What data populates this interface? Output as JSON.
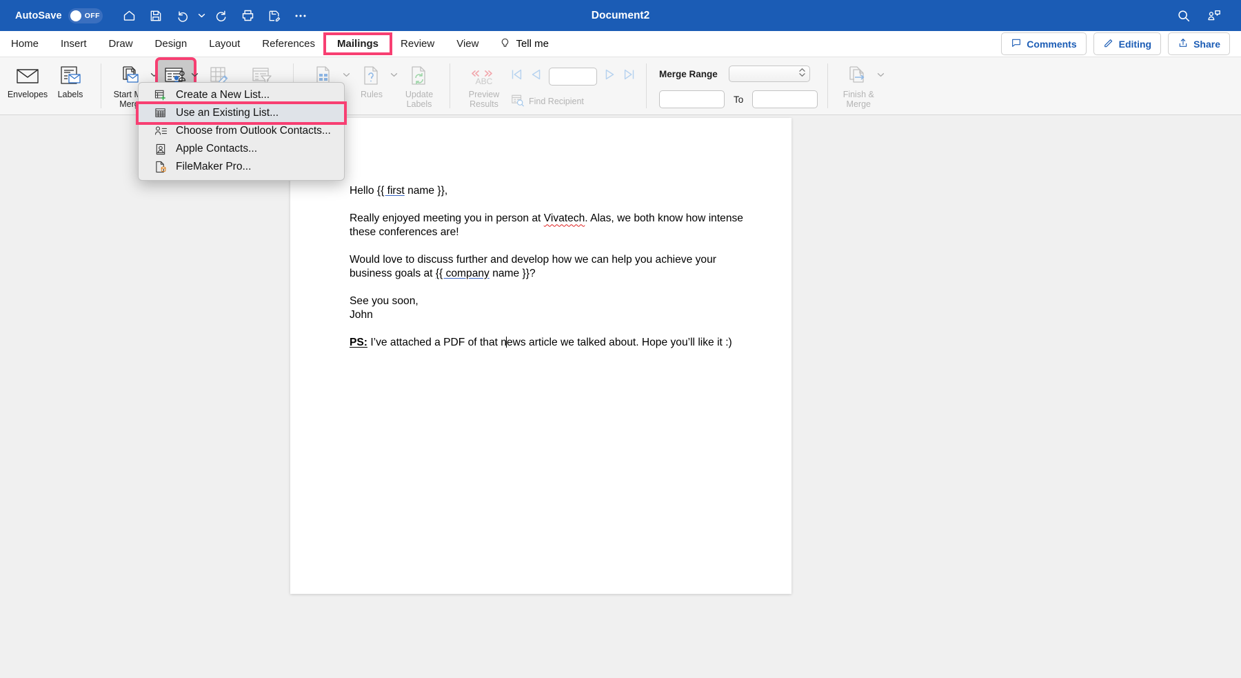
{
  "titlebar": {
    "autosave_label": "AutoSave",
    "autosave_state": "OFF",
    "document_title": "Document2",
    "icons": [
      "home-icon",
      "save-icon",
      "undo-icon",
      "undo-dropdown-caret",
      "redo-icon",
      "print-icon",
      "save-as-icon",
      "more-options-icon"
    ],
    "right_icons": [
      "search-icon",
      "collaborate-icon"
    ],
    "accent_color": "#1b5cb5"
  },
  "tabs": [
    {
      "label": "Home",
      "highlighted": false
    },
    {
      "label": "Insert",
      "highlighted": false
    },
    {
      "label": "Draw",
      "highlighted": false
    },
    {
      "label": "Design",
      "highlighted": false
    },
    {
      "label": "Layout",
      "highlighted": false
    },
    {
      "label": "References",
      "highlighted": false
    },
    {
      "label": "Mailings",
      "highlighted": true
    },
    {
      "label": "Review",
      "highlighted": false
    },
    {
      "label": "View",
      "highlighted": false
    }
  ],
  "tellme": {
    "label": "Tell me",
    "icon": "lightbulb-icon"
  },
  "tabbar_right": {
    "comments": {
      "label": "Comments",
      "icon": "comment-icon"
    },
    "editing": {
      "label": "Editing",
      "icon": "pencil-icon"
    },
    "share": {
      "label": "Share",
      "icon": "share-icon"
    }
  },
  "ribbon": {
    "create_group": [
      {
        "label": "Envelopes",
        "icon": "envelope-icon",
        "disabled": false
      },
      {
        "label": "Labels",
        "icon": "labels-icon",
        "disabled": false
      }
    ],
    "start_group": [
      {
        "label": "Start Mail\nMerge",
        "label_line1": "Start Mail",
        "label_line2": "Merge",
        "icon": "start-mail-merge-icon",
        "disabled": false,
        "has_caret": true
      },
      {
        "label": "",
        "icon": "select-recipients-icon",
        "disabled": false,
        "has_caret": true,
        "active": true
      },
      {
        "label": "",
        "icon": "edit-recipient-list-icon",
        "disabled": true,
        "has_caret": false
      },
      {
        "label": "",
        "icon": "filter-recipients-icon",
        "disabled": true,
        "has_caret": false
      }
    ],
    "write_group": [
      {
        "label": "",
        "icon": "insert-merge-field-icon",
        "disabled": true,
        "has_caret": true
      },
      {
        "label": "Rules",
        "icon": "rules-icon",
        "disabled": true,
        "has_caret": true
      },
      {
        "label_line1": "Update",
        "label_line2": "Labels",
        "icon": "update-labels-icon",
        "disabled": true,
        "has_caret": false
      }
    ],
    "preview_group": {
      "preview_results": {
        "label_line1": "Preview",
        "label_line2": "Results",
        "icon": "abc-preview-icon"
      },
      "nav": [
        "first-record-icon",
        "previous-record-icon",
        "next-record-icon",
        "last-record-icon"
      ],
      "record_value": "",
      "find_recipient": {
        "label": "Find Recipient",
        "icon": "find-recipient-icon"
      }
    },
    "merge_range": {
      "label": "Merge Range",
      "select_value": "",
      "from_value": "",
      "to_label": "To",
      "to_value": ""
    },
    "finish": {
      "label_line1": "Finish &",
      "label_line2": "Merge",
      "icon": "finish-merge-icon",
      "has_caret": true
    }
  },
  "menu": {
    "items": [
      {
        "label": "Create a New List...",
        "icon": "new-list-icon",
        "selected": false,
        "highlighted": false
      },
      {
        "label": "Use an Existing List...",
        "icon": "existing-list-icon",
        "selected": true,
        "highlighted": true
      },
      {
        "label": "Choose from Outlook Contacts...",
        "icon": "outlook-contacts-icon",
        "selected": false,
        "highlighted": false
      },
      {
        "label": "Apple Contacts...",
        "icon": "apple-contacts-icon",
        "selected": false,
        "highlighted": false
      },
      {
        "label": "FileMaker Pro...",
        "icon": "filemaker-icon",
        "selected": false,
        "highlighted": false
      }
    ]
  },
  "document": {
    "greeting_prefix": "Hello ",
    "greeting_field": "{{ first",
    "greeting_suffix": " name }},",
    "p2_a": "Really enjoyed meeting you in person at ",
    "p2_spell": "Vivatech",
    "p2_b": ". Alas, we both know how intense these conferences are!",
    "p3_a": "Would love to discuss further and develop how we can help you achieve your business goals at ",
    "p3_field": "{{ company",
    "p3_b": " name }}?",
    "signoff_line1": "See you soon,",
    "signoff_line2": "John",
    "ps_tag": "PS:",
    "ps_a": " I’ve attached a PDF of that n",
    "ps_b": "ews article we talked about. Hope you’ll like it :)"
  },
  "annotation_color": "#f73f72"
}
